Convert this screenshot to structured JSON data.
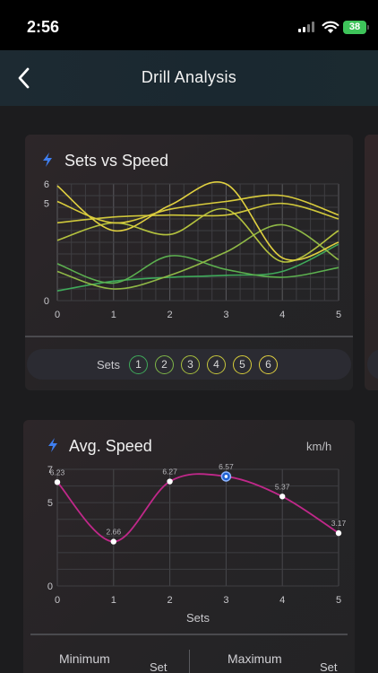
{
  "status_bar": {
    "time": "2:56",
    "battery": "38"
  },
  "nav": {
    "title": "Drill Analysis"
  },
  "sets_card": {
    "title": "Sets vs Speed",
    "sets_label": "Sets",
    "set_buttons": [
      {
        "label": "1",
        "color": "#3faa5a"
      },
      {
        "label": "2",
        "color": "#7fb648"
      },
      {
        "label": "3",
        "color": "#a8bf3e"
      },
      {
        "label": "4",
        "color": "#c6c63c"
      },
      {
        "label": "5",
        "color": "#d6cc3a"
      },
      {
        "label": "6",
        "color": "#e0d040"
      }
    ]
  },
  "speed_card": {
    "title": "Avg. Speed",
    "unit": "km/h",
    "min_label": "Minimum",
    "max_label": "Maximum",
    "min_unit": "Set",
    "max_unit": "Set"
  },
  "chart_data": [
    {
      "type": "line",
      "title": "Sets vs Speed",
      "x": [
        0,
        1,
        2,
        3,
        4,
        5
      ],
      "xlim": [
        0,
        5
      ],
      "ylim": [
        0,
        6
      ],
      "y_ticks": [
        0,
        5,
        6
      ],
      "grid": true,
      "series": [
        {
          "color": "#3faa5a",
          "values": [
            0.5,
            1.0,
            1.2,
            1.3,
            1.5,
            2.9
          ]
        },
        {
          "color": "#5cb04f",
          "values": [
            1.9,
            0.9,
            2.3,
            1.6,
            1.2,
            1.7
          ]
        },
        {
          "color": "#8fb846",
          "values": [
            1.5,
            0.6,
            1.3,
            2.5,
            3.9,
            2.1
          ]
        },
        {
          "color": "#b4c23e",
          "values": [
            3.1,
            4.0,
            3.4,
            4.7,
            2.0,
            3.6
          ]
        },
        {
          "color": "#cfc73b",
          "values": [
            4.0,
            4.3,
            4.4,
            4.4,
            5.0,
            4.2
          ]
        },
        {
          "color": "#e0d040",
          "values": [
            5.9,
            3.6,
            4.9,
            6.0,
            2.2,
            3.0
          ]
        },
        {
          "color": "#d9cc3c",
          "values": [
            5.1,
            4.0,
            4.7,
            5.1,
            5.4,
            4.4
          ]
        }
      ]
    },
    {
      "type": "line",
      "title": "Avg. Speed",
      "xlabel": "Sets",
      "x": [
        0,
        1,
        2,
        3,
        4,
        5
      ],
      "values": [
        6.23,
        2.66,
        6.27,
        6.57,
        5.37,
        3.17
      ],
      "value_labels": [
        "6.23",
        "2.66",
        "6.27",
        "6.57",
        "5.37",
        "3.17"
      ],
      "highlight_index": 3,
      "xlim": [
        0,
        5
      ],
      "ylim": [
        0,
        7
      ],
      "y_ticks": [
        0,
        5,
        7
      ],
      "line_color": "#c0288a",
      "grid": true
    }
  ]
}
